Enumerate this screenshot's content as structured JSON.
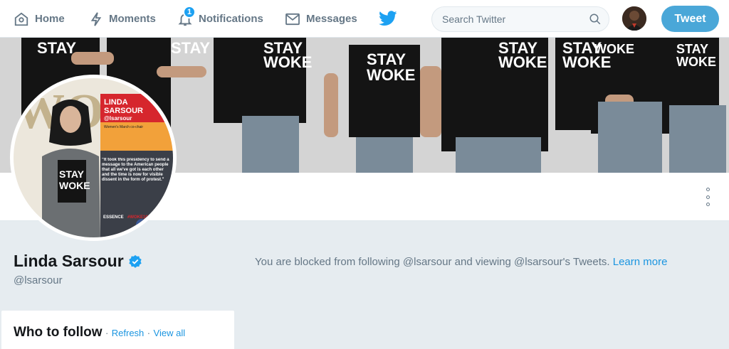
{
  "nav": {
    "home_label": "Home",
    "moments_label": "Moments",
    "notifications_label": "Notifications",
    "notifications_count": "1",
    "messages_label": "Messages",
    "search_placeholder": "Search Twitter",
    "tweet_button": "Tweet"
  },
  "profile": {
    "name": "Linda Sarsour",
    "handle": "@lsarsour",
    "verified": true
  },
  "banner": {
    "shirt_slogan_line1": "STAY",
    "shirt_slogan_line2": "WOKE"
  },
  "avatar_card": {
    "name_line1": "LINDA",
    "name_line2": "SARSOUR",
    "handle": "@lsarsour",
    "role": "Women's March co-chair",
    "quote": "\"It took this presidency to send a message to the American people that all we've got is each other and the time is now for visible dissent in the form of protest.\"",
    "brand": "ESSENCE",
    "hashtag": "#WOKE100",
    "shirt_line1": "STAY",
    "shirt_line2": "WOKE",
    "side_letters": "WO"
  },
  "blocked_notice": {
    "text": "You are blocked from following @lsarsour and viewing @lsarsour's Tweets.",
    "link": "Learn more"
  },
  "who_to_follow": {
    "title": "Who to follow",
    "separator": "·",
    "refresh": "Refresh",
    "view_all": "View all"
  },
  "colors": {
    "accent": "#1da1f2",
    "link": "#1b95e0",
    "tweet_button": "#4aa7d8",
    "background": "#e6ecf0"
  },
  "icons": [
    "home-icon",
    "moments-icon",
    "bell-icon",
    "envelope-icon",
    "twitter-bird-icon",
    "search-icon",
    "more-icon",
    "verified-badge-icon"
  ]
}
